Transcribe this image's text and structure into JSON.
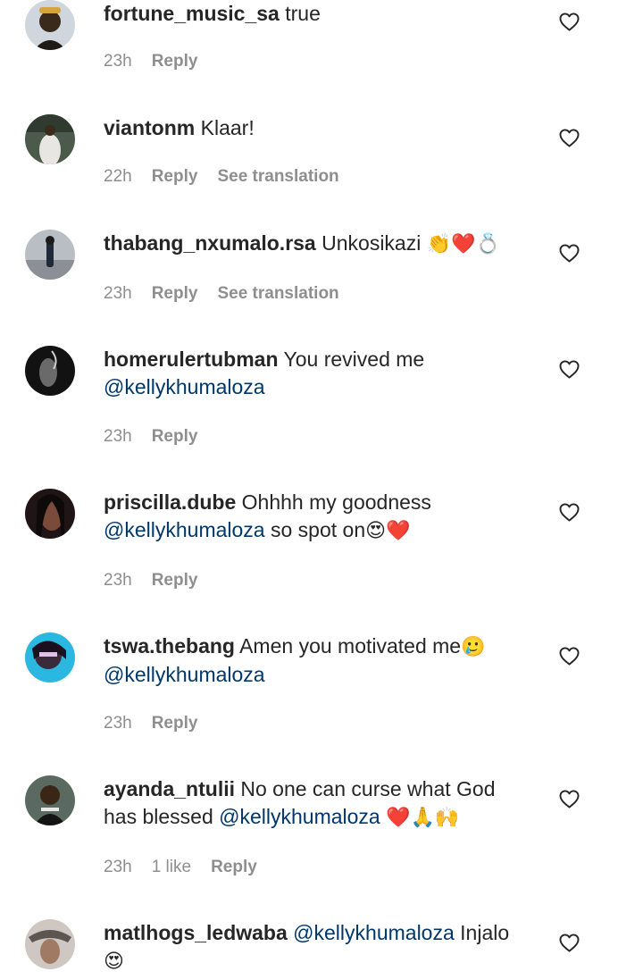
{
  "comments": [
    {
      "username": "fortune_music_sa",
      "text": "true",
      "time": "23h",
      "reply": "Reply",
      "avatar_color": "#2b2418"
    },
    {
      "username": "viantonm",
      "text": "Klaar!",
      "time": "22h",
      "reply": "Reply",
      "translation": "See translation",
      "avatar_color": "#3a4a3a"
    },
    {
      "username": "thabang_nxumalo.rsa",
      "text": "Unkosikazi",
      "emoji": "👏❤️💍",
      "time": "23h",
      "reply": "Reply",
      "translation": "See translation",
      "avatar_color": "#8a8f96"
    },
    {
      "username": "homerulertubman",
      "text": "You revived me",
      "mention": "@kellykhumaloza",
      "time": "23h",
      "reply": "Reply",
      "avatar_color": "#1c1c1c"
    },
    {
      "username": "priscilla.dube",
      "text": "Ohhhh my goodness",
      "mention": "@kellykhumaloza",
      "text_after": "so spot on",
      "emoji": "😍❤️",
      "time": "23h",
      "reply": "Reply",
      "avatar_color": "#3b2a2a"
    },
    {
      "username": "tswa.thebang",
      "text": "Amen you motivated me",
      "emoji": "🥲",
      "mention": "@kellykhumaloza",
      "time": "23h",
      "reply": "Reply",
      "avatar_color": "#2a2040"
    },
    {
      "username": "ayanda_ntulii",
      "text": "No one can curse what God has blessed",
      "mention": "@kellykhumaloza",
      "emoji": "❤️🙏🙌",
      "time": "23h",
      "likes": "1 like",
      "reply": "Reply",
      "avatar_color": "#2f3a35"
    },
    {
      "username": "matlhogs_ledwaba",
      "mention": "@kellykhumaloza",
      "text": "Injalo",
      "emoji": "😍",
      "avatar_color": "#6b625c"
    }
  ],
  "colors": {
    "username": "#262626",
    "mention": "#00376b",
    "meta": "#8e8e8e",
    "background": "#ffffff"
  },
  "icons": {
    "like": "heart-outline-icon"
  }
}
